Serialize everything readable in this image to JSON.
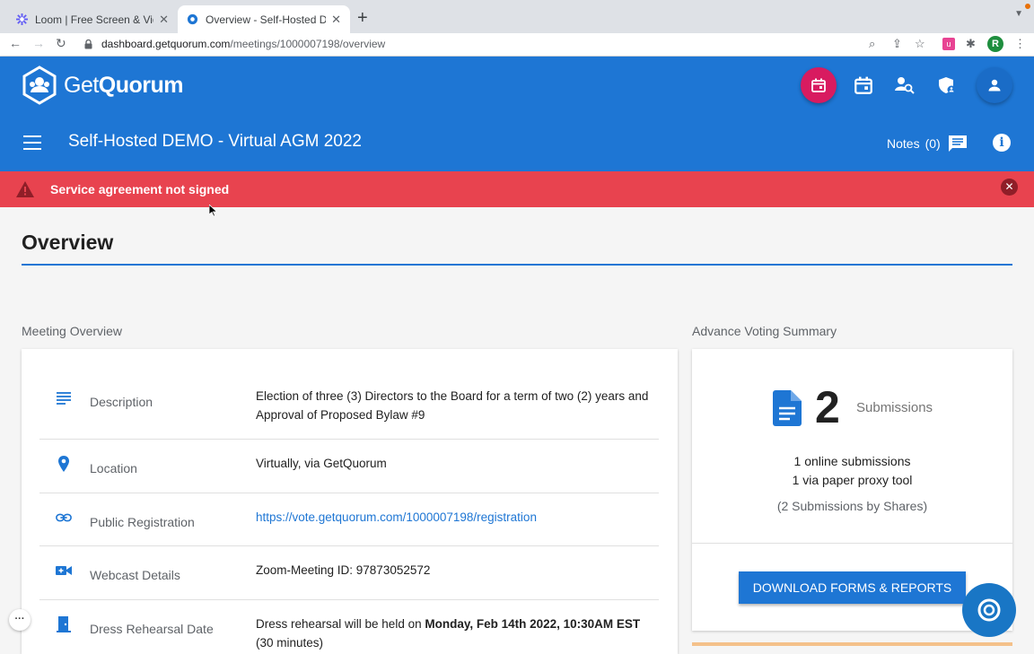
{
  "browser": {
    "tabs": [
      {
        "title": "Loom | Free Screen & Video Re",
        "icon": "loom-icon"
      },
      {
        "title": "Overview - Self-Hosted DEMO",
        "icon": "getquorum-icon"
      }
    ],
    "url_domain": "dashboard.getquorum.com",
    "url_path": "/meetings/1000007198/overview",
    "profile_initial": "R"
  },
  "header": {
    "logo_prefix": "Get",
    "logo_suffix": "Quorum",
    "meeting_title": "Self-Hosted DEMO - Virtual AGM 2022",
    "notes_label": "Notes",
    "notes_count": "(0)",
    "accent_color": "#1e76d4",
    "action_color": "#d81b60"
  },
  "alert": {
    "message": "Service agreement not signed",
    "color": "#e8434f"
  },
  "page": {
    "title": "Overview"
  },
  "meeting_overview": {
    "heading": "Meeting Overview",
    "rows": [
      {
        "label": "Description",
        "value": "Election of three (3) Directors to the Board for a term of two (2) years and Approval of Proposed Bylaw #9",
        "icon": "description-icon"
      },
      {
        "label": "Location",
        "value": "Virtually, via GetQuorum",
        "icon": "location-pin-icon"
      },
      {
        "label": "Public Registration",
        "value": "https://vote.getquorum.com/1000007198/registration",
        "icon": "link-icon"
      },
      {
        "label": "Webcast Details",
        "value": "Zoom-Meeting ID: 97873052572",
        "icon": "video-camera-icon"
      },
      {
        "label": "Dress Rehearsal Date",
        "value_prefix": "Dress rehearsal will be held on ",
        "value_bold": "Monday, Feb 14th 2022, 10:30AM EST",
        "value_suffix": " (30 minutes)",
        "icon": "door-icon"
      }
    ]
  },
  "advance_voting": {
    "heading": "Advance Voting Summary",
    "count": "2",
    "count_label": "Submissions",
    "online": "1 online submissions",
    "paper": "1 via paper proxy tool",
    "by_shares": "(2 Submissions by Shares)",
    "download_label": "DOWNLOAD FORMS & REPORTS"
  }
}
